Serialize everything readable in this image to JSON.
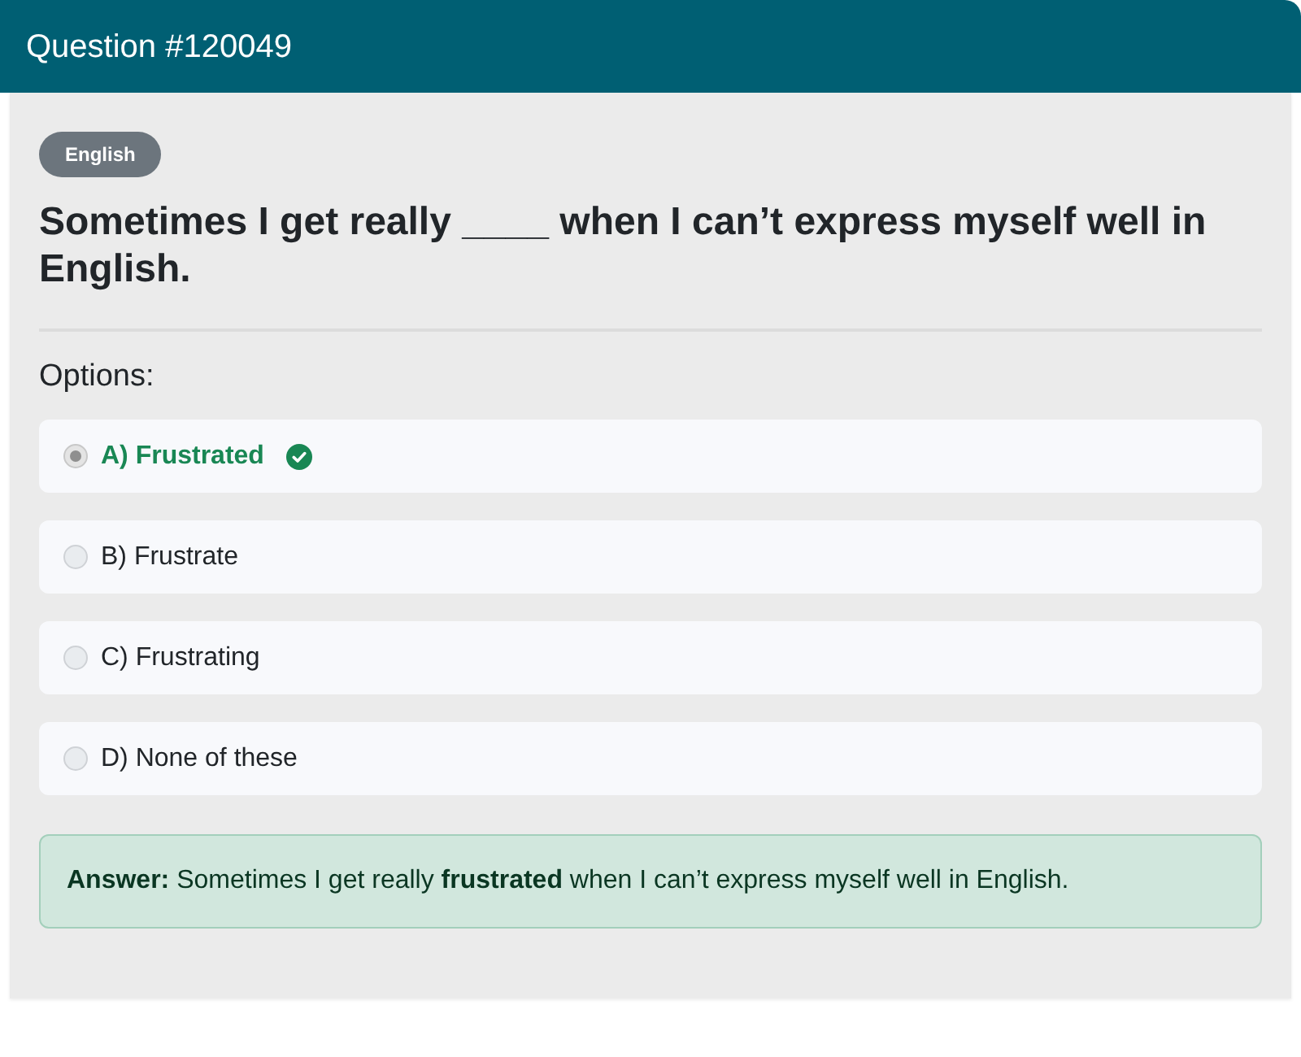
{
  "header": {
    "title": "Question #120049"
  },
  "question": {
    "category": "English",
    "text": "Sometimes I get really ____ when I can’t express myself well in English."
  },
  "options_label": "Options:",
  "options": [
    {
      "label": "A) Frustrated",
      "selected": true,
      "correct": true
    },
    {
      "label": "B) Frustrate",
      "selected": false,
      "correct": false
    },
    {
      "label": "C) Frustrating",
      "selected": false,
      "correct": false
    },
    {
      "label": "D) None of these",
      "selected": false,
      "correct": false
    }
  ],
  "answer": {
    "text": "**Answer:** Sometimes I get really **frustrated** when I can’t express myself well in English."
  }
}
